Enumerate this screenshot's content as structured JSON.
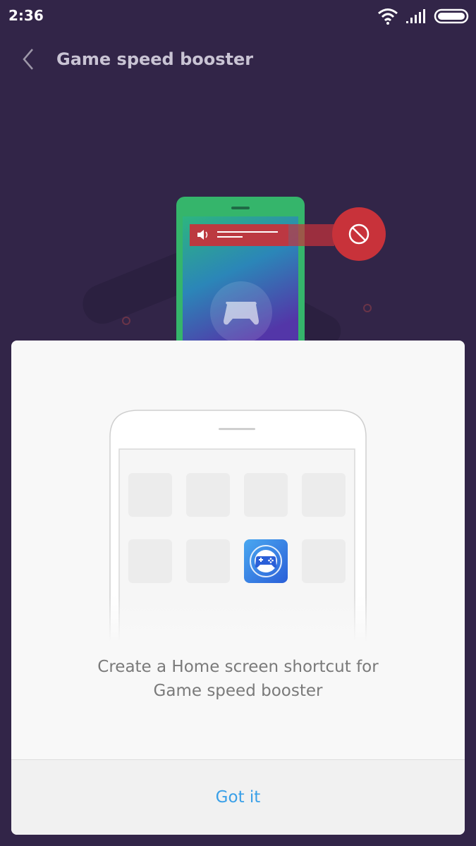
{
  "status_bar": {
    "time": "2:36",
    "icons": [
      "wifi-icon",
      "signal-icon",
      "battery-icon"
    ]
  },
  "header": {
    "title": "Game speed booster",
    "back_icon": "chevron-left-icon"
  },
  "dialog": {
    "message_line1": "Create a Home screen shortcut for",
    "message_line2": "Game speed booster",
    "button_label": "Got it"
  },
  "colors": {
    "background": "#322548",
    "accent": "#3aa0e8",
    "block_red": "#c8323a",
    "phone_green": "#35b56b"
  }
}
